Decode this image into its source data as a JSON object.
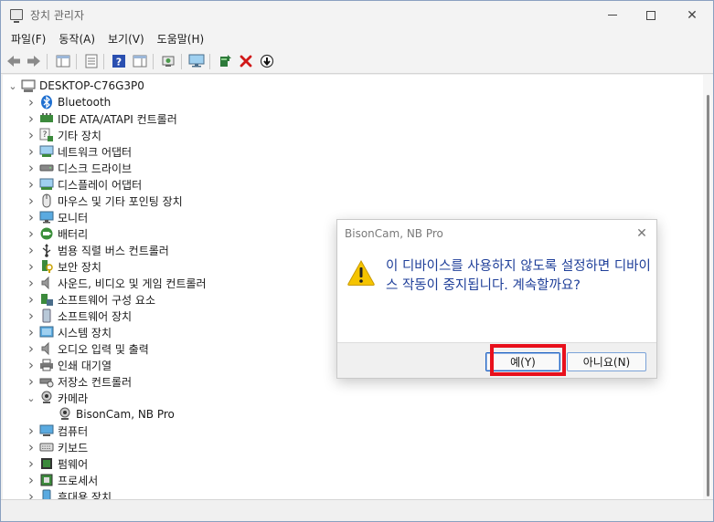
{
  "window": {
    "title": "장치 관리자",
    "min_glyph": "—",
    "max_glyph": "☐",
    "close_glyph": "✕"
  },
  "menu": {
    "items": [
      {
        "label": "파일(F)"
      },
      {
        "label": "동작(A)"
      },
      {
        "label": "보기(V)"
      },
      {
        "label": "도움말(H)"
      }
    ]
  },
  "toolbar": {
    "icons": [
      "back-icon",
      "forward-icon",
      "show-hide-tree-icon",
      "properties-icon",
      "help-icon",
      "action-pane-icon",
      "update-driver-icon",
      "scan-hardware-icon",
      "add-legacy-icon",
      "uninstall-icon",
      "disable-icon"
    ]
  },
  "tree": {
    "root": "DESKTOP-C76G3P0",
    "items": [
      {
        "label": "Bluetooth",
        "icon": "bluetooth-icon"
      },
      {
        "label": "IDE ATA/ATAPI 컨트롤러",
        "icon": "ide-controller-icon"
      },
      {
        "label": "기타 장치",
        "icon": "other-devices-icon"
      },
      {
        "label": "네트워크 어댑터",
        "icon": "network-adapter-icon"
      },
      {
        "label": "디스크 드라이브",
        "icon": "disk-drive-icon"
      },
      {
        "label": "디스플레이 어댑터",
        "icon": "display-adapter-icon"
      },
      {
        "label": "마우스 및 기타 포인팅 장치",
        "icon": "mouse-icon"
      },
      {
        "label": "모니터",
        "icon": "monitor-icon"
      },
      {
        "label": "배터리",
        "icon": "battery-icon"
      },
      {
        "label": "범용 직렬 버스 컨트롤러",
        "icon": "usb-icon"
      },
      {
        "label": "보안 장치",
        "icon": "security-device-icon"
      },
      {
        "label": "사운드, 비디오 및 게임 컨트롤러",
        "icon": "sound-icon"
      },
      {
        "label": "소프트웨어 구성 요소",
        "icon": "software-component-icon"
      },
      {
        "label": "소프트웨어 장치",
        "icon": "software-device-icon"
      },
      {
        "label": "시스템 장치",
        "icon": "system-device-icon"
      },
      {
        "label": "오디오 입력 및 출력",
        "icon": "audio-io-icon"
      },
      {
        "label": "인쇄 대기열",
        "icon": "print-queue-icon"
      },
      {
        "label": "저장소 컨트롤러",
        "icon": "storage-controller-icon"
      },
      {
        "label": "카메라",
        "icon": "camera-icon",
        "expanded": true
      },
      {
        "label": "BisonCam, NB Pro",
        "icon": "webcam-icon",
        "child": true
      },
      {
        "label": "컴퓨터",
        "icon": "computer-icon"
      },
      {
        "label": "키보드",
        "icon": "keyboard-icon"
      },
      {
        "label": "펌웨어",
        "icon": "firmware-icon"
      },
      {
        "label": "프로세서",
        "icon": "processor-icon"
      },
      {
        "label": "휴대용 장치",
        "icon": "portable-device-icon"
      }
    ]
  },
  "dialog": {
    "title": "BisonCam, NB Pro",
    "message": "이 디바이스를 사용하지 않도록 설정하면 디바이스 작동이 중지됩니다. 계속할까요?",
    "yes_label": "예(Y)",
    "no_label": "아니요(N)",
    "close_glyph": "✕"
  },
  "colors": {
    "message_text": "#1f3f99",
    "highlight_box": "#e8101c",
    "warning_fill": "#f5c400"
  }
}
